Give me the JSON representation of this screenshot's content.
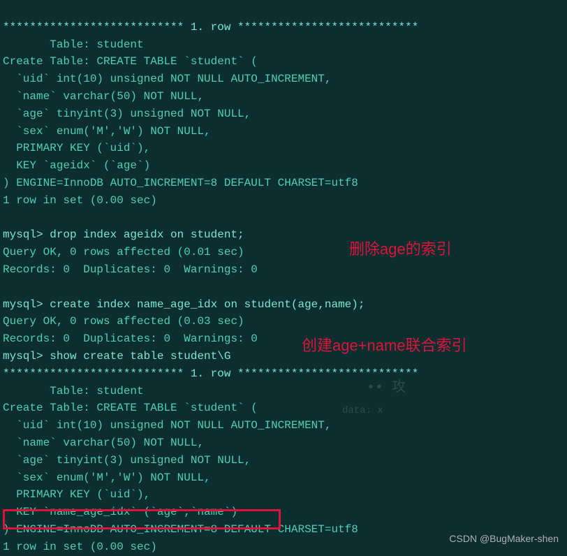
{
  "row_header1": "*************************** 1. row ***************************",
  "table_line1": "       Table: student",
  "create_line1": "Create Table: CREATE TABLE `student` (",
  "col_uid1": "  `uid` int(10) unsigned NOT NULL AUTO_INCREMENT,",
  "col_name1": "  `name` varchar(50) NOT NULL,",
  "col_age1": "  `age` tinyint(3) unsigned NOT NULL,",
  "col_sex1": "  `sex` enum('M','W') NOT NULL,",
  "pk1": "  PRIMARY KEY (`uid`),",
  "key1": "  KEY `ageidx` (`age`)",
  "engine1": ") ENGINE=InnoDB AUTO_INCREMENT=8 DEFAULT CHARSET=utf8",
  "rowset1": "1 row in set (0.00 sec)",
  "blank": "",
  "prompt_drop": "mysql> drop index ageidx on student;",
  "query_ok1": "Query OK, 0 rows affected (0.01 sec)",
  "records1": "Records: 0  Duplicates: 0  Warnings: 0",
  "prompt_create": "mysql> create index name_age_idx on student(age,name);",
  "query_ok2": "Query OK, 0 rows affected (0.03 sec)",
  "records2": "Records: 0  Duplicates: 0  Warnings: 0",
  "prompt_show": "mysql> show create table student\\G",
  "row_header2": "*************************** 1. row ***************************",
  "table_line2": "       Table: student",
  "create_line2": "Create Table: CREATE TABLE `student` (",
  "col_uid2": "  `uid` int(10) unsigned NOT NULL AUTO_INCREMENT,",
  "col_name2": "  `name` varchar(50) NOT NULL,",
  "col_age2": "  `age` tinyint(3) unsigned NOT NULL,",
  "col_sex2": "  `sex` enum('M','W') NOT NULL,",
  "pk2": "  PRIMARY KEY (`uid`),",
  "key2": "  KEY `name_age_idx` (`age`,`name`)",
  "engine2": ") ENGINE=InnoDB AUTO_INCREMENT=8 DEFAULT CHARSET=utf8",
  "rowset2": "1 row in set (0.00 sec)",
  "annotation1": "删除age的索引",
  "annotation2": "创建age+name联合索引",
  "watermark": "CSDN @BugMaker-shen",
  "faint_data": "data:  x",
  "faint_sym": "••   攻"
}
